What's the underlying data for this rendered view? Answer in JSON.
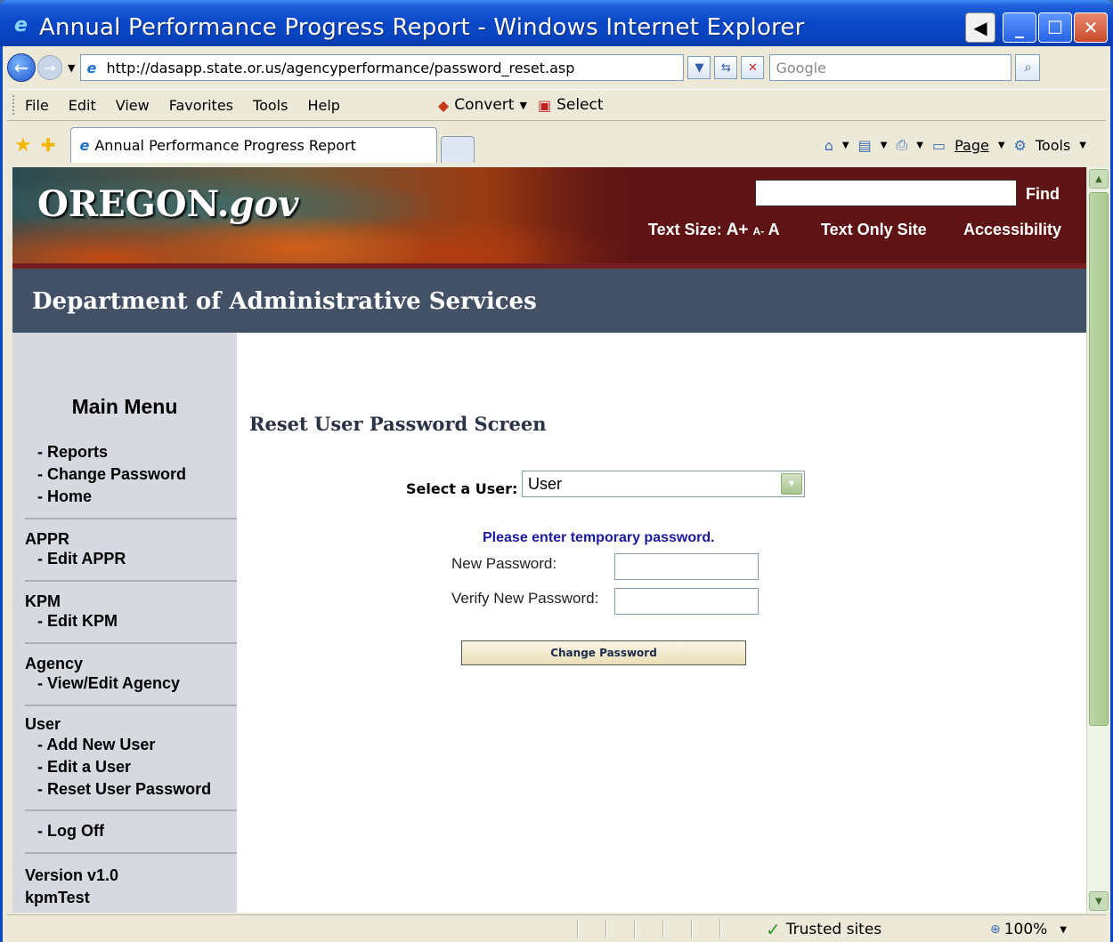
{
  "window": {
    "title": "Annual Performance Progress Report - Windows Internet Explorer"
  },
  "address_bar": {
    "url": "http://dasapp.state.or.us/agencyperformance/password_reset.asp",
    "search_placeholder": "Google"
  },
  "menu": {
    "items": [
      "File",
      "Edit",
      "View",
      "Favorites",
      "Tools",
      "Help"
    ],
    "convert_label": "Convert",
    "select_label": "Select"
  },
  "tabs": {
    "active_tab": "Annual Performance Progress Report"
  },
  "command_bar": {
    "page_label": "Page",
    "tools_label": "Tools"
  },
  "site_header": {
    "logo_main": "OREGON.",
    "logo_suffix": "gov",
    "find_label": "Find",
    "text_size_label": "Text Size:",
    "text_size_plus": "A+",
    "text_size_minus": "A-",
    "text_size_normal": "A",
    "text_only_label": "Text Only Site",
    "accessibility_label": "Accessibility",
    "department": "Department of Administrative Services"
  },
  "sidebar": {
    "main_menu_title": "Main Menu",
    "main_links": [
      "- Reports",
      "- Change Password",
      "- Home"
    ],
    "appr_title": "APPR",
    "appr_links": [
      "- Edit APPR"
    ],
    "kpm_title": "KPM",
    "kpm_links": [
      "- Edit KPM"
    ],
    "agency_title": "Agency",
    "agency_links": [
      "- View/Edit Agency"
    ],
    "user_title": "User",
    "user_links": [
      "- Add New User",
      "- Edit a User",
      "- Reset User Password"
    ],
    "logoff_link": "- Log Off",
    "version": "Version v1.0",
    "user_name": "kpmTest"
  },
  "form": {
    "title": "Reset User Password Screen",
    "select_label": "Select a User:",
    "select_value": "User",
    "prompt": "Please enter temporary password.",
    "new_password_label": "New Password:",
    "verify_password_label": "Verify New Password:",
    "submit_label": "Change Password"
  },
  "status_bar": {
    "zone": "Trusted sites",
    "zoom": "100%"
  }
}
